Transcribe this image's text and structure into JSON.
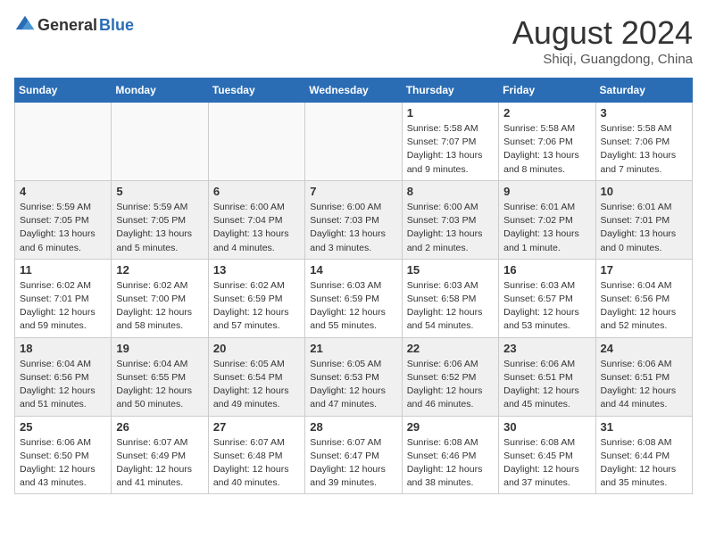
{
  "header": {
    "logo_general": "General",
    "logo_blue": "Blue",
    "month_year": "August 2024",
    "location": "Shiqi, Guangdong, China"
  },
  "weekdays": [
    "Sunday",
    "Monday",
    "Tuesday",
    "Wednesday",
    "Thursday",
    "Friday",
    "Saturday"
  ],
  "weeks": [
    [
      {
        "day": "",
        "info": ""
      },
      {
        "day": "",
        "info": ""
      },
      {
        "day": "",
        "info": ""
      },
      {
        "day": "",
        "info": ""
      },
      {
        "day": "1",
        "info": "Sunrise: 5:58 AM\nSunset: 7:07 PM\nDaylight: 13 hours and 9 minutes."
      },
      {
        "day": "2",
        "info": "Sunrise: 5:58 AM\nSunset: 7:06 PM\nDaylight: 13 hours and 8 minutes."
      },
      {
        "day": "3",
        "info": "Sunrise: 5:58 AM\nSunset: 7:06 PM\nDaylight: 13 hours and 7 minutes."
      }
    ],
    [
      {
        "day": "4",
        "info": "Sunrise: 5:59 AM\nSunset: 7:05 PM\nDaylight: 13 hours and 6 minutes."
      },
      {
        "day": "5",
        "info": "Sunrise: 5:59 AM\nSunset: 7:05 PM\nDaylight: 13 hours and 5 minutes."
      },
      {
        "day": "6",
        "info": "Sunrise: 6:00 AM\nSunset: 7:04 PM\nDaylight: 13 hours and 4 minutes."
      },
      {
        "day": "7",
        "info": "Sunrise: 6:00 AM\nSunset: 7:03 PM\nDaylight: 13 hours and 3 minutes."
      },
      {
        "day": "8",
        "info": "Sunrise: 6:00 AM\nSunset: 7:03 PM\nDaylight: 13 hours and 2 minutes."
      },
      {
        "day": "9",
        "info": "Sunrise: 6:01 AM\nSunset: 7:02 PM\nDaylight: 13 hours and 1 minute."
      },
      {
        "day": "10",
        "info": "Sunrise: 6:01 AM\nSunset: 7:01 PM\nDaylight: 13 hours and 0 minutes."
      }
    ],
    [
      {
        "day": "11",
        "info": "Sunrise: 6:02 AM\nSunset: 7:01 PM\nDaylight: 12 hours and 59 minutes."
      },
      {
        "day": "12",
        "info": "Sunrise: 6:02 AM\nSunset: 7:00 PM\nDaylight: 12 hours and 58 minutes."
      },
      {
        "day": "13",
        "info": "Sunrise: 6:02 AM\nSunset: 6:59 PM\nDaylight: 12 hours and 57 minutes."
      },
      {
        "day": "14",
        "info": "Sunrise: 6:03 AM\nSunset: 6:59 PM\nDaylight: 12 hours and 55 minutes."
      },
      {
        "day": "15",
        "info": "Sunrise: 6:03 AM\nSunset: 6:58 PM\nDaylight: 12 hours and 54 minutes."
      },
      {
        "day": "16",
        "info": "Sunrise: 6:03 AM\nSunset: 6:57 PM\nDaylight: 12 hours and 53 minutes."
      },
      {
        "day": "17",
        "info": "Sunrise: 6:04 AM\nSunset: 6:56 PM\nDaylight: 12 hours and 52 minutes."
      }
    ],
    [
      {
        "day": "18",
        "info": "Sunrise: 6:04 AM\nSunset: 6:56 PM\nDaylight: 12 hours and 51 minutes."
      },
      {
        "day": "19",
        "info": "Sunrise: 6:04 AM\nSunset: 6:55 PM\nDaylight: 12 hours and 50 minutes."
      },
      {
        "day": "20",
        "info": "Sunrise: 6:05 AM\nSunset: 6:54 PM\nDaylight: 12 hours and 49 minutes."
      },
      {
        "day": "21",
        "info": "Sunrise: 6:05 AM\nSunset: 6:53 PM\nDaylight: 12 hours and 47 minutes."
      },
      {
        "day": "22",
        "info": "Sunrise: 6:06 AM\nSunset: 6:52 PM\nDaylight: 12 hours and 46 minutes."
      },
      {
        "day": "23",
        "info": "Sunrise: 6:06 AM\nSunset: 6:51 PM\nDaylight: 12 hours and 45 minutes."
      },
      {
        "day": "24",
        "info": "Sunrise: 6:06 AM\nSunset: 6:51 PM\nDaylight: 12 hours and 44 minutes."
      }
    ],
    [
      {
        "day": "25",
        "info": "Sunrise: 6:06 AM\nSunset: 6:50 PM\nDaylight: 12 hours and 43 minutes."
      },
      {
        "day": "26",
        "info": "Sunrise: 6:07 AM\nSunset: 6:49 PM\nDaylight: 12 hours and 41 minutes."
      },
      {
        "day": "27",
        "info": "Sunrise: 6:07 AM\nSunset: 6:48 PM\nDaylight: 12 hours and 40 minutes."
      },
      {
        "day": "28",
        "info": "Sunrise: 6:07 AM\nSunset: 6:47 PM\nDaylight: 12 hours and 39 minutes."
      },
      {
        "day": "29",
        "info": "Sunrise: 6:08 AM\nSunset: 6:46 PM\nDaylight: 12 hours and 38 minutes."
      },
      {
        "day": "30",
        "info": "Sunrise: 6:08 AM\nSunset: 6:45 PM\nDaylight: 12 hours and 37 minutes."
      },
      {
        "day": "31",
        "info": "Sunrise: 6:08 AM\nSunset: 6:44 PM\nDaylight: 12 hours and 35 minutes."
      }
    ]
  ]
}
